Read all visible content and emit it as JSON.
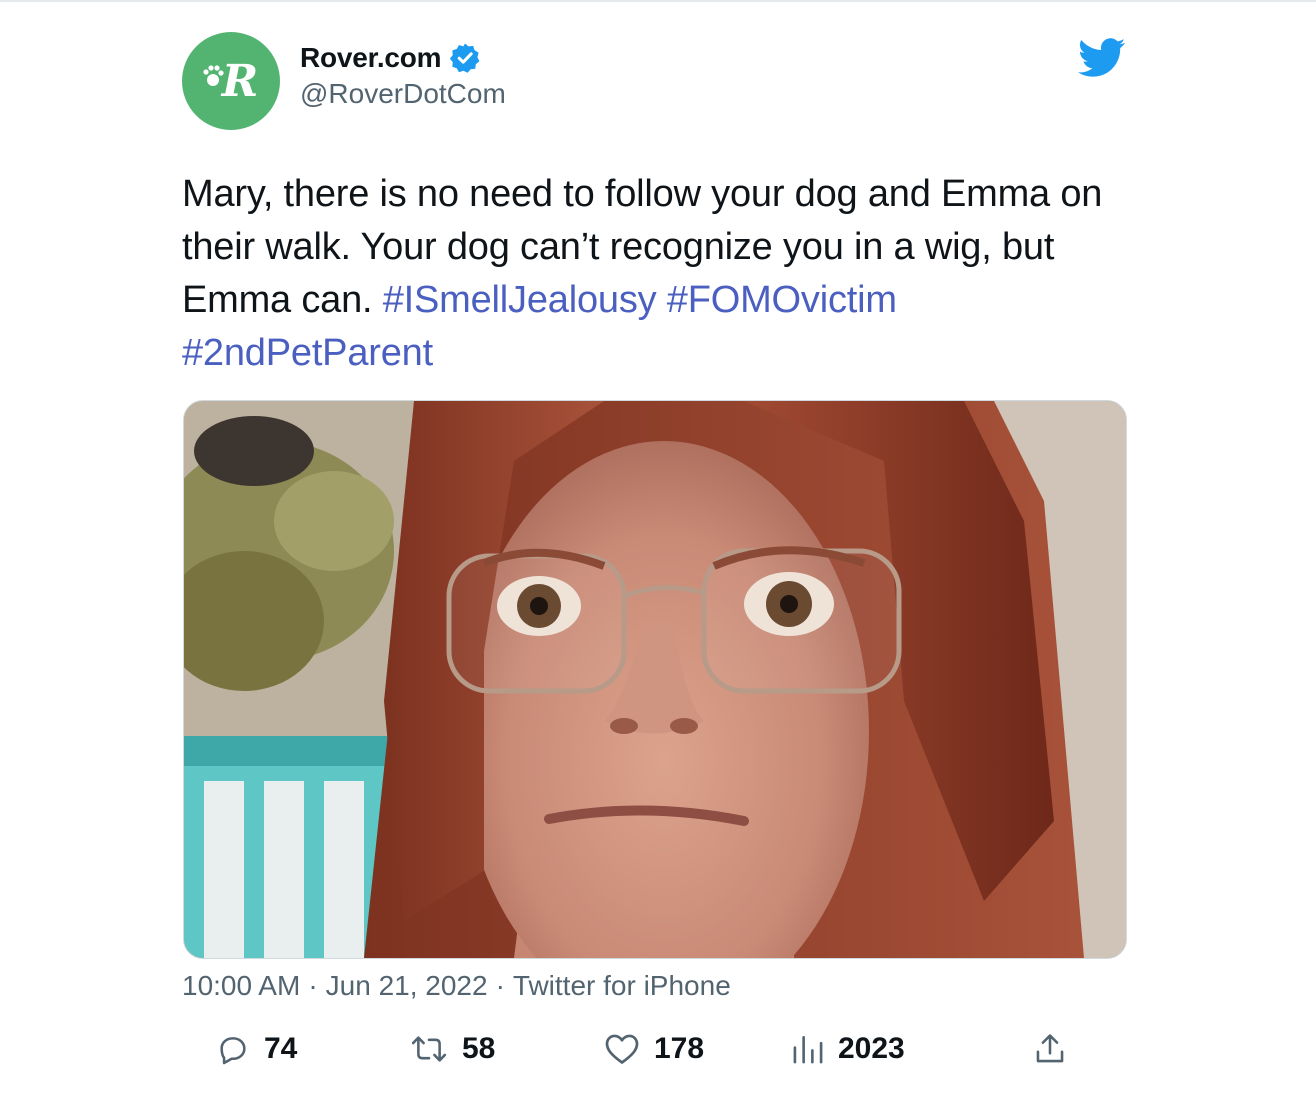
{
  "tweet": {
    "display_name": "Rover.com",
    "handle": "@RoverDotCom",
    "avatar_letter": "R",
    "verified": true,
    "text_plain": "Mary, there is no need to follow your dog and Emma on their walk. Your dog can’t recognize you in a wig, but Emma can.",
    "hashtags": [
      "#ISmellJealousy",
      "#FOMOvictim",
      "#2ndPetParent"
    ],
    "time": "10:00 AM",
    "date": "Jun 21, 2022",
    "source": "Twitter for iPhone",
    "separator": "·"
  },
  "actions": {
    "replies": "74",
    "retweets": "58",
    "likes": "178",
    "views": "2023"
  },
  "icons": {
    "brand": "twitter-bird-icon",
    "verified": "verified-badge-icon",
    "reply": "reply-icon",
    "retweet": "retweet-icon",
    "like": "heart-icon",
    "views": "views-icon",
    "share": "share-icon"
  },
  "colors": {
    "avatar_green": "#53b472",
    "twitter_blue": "#1d9bf0",
    "hashtag_blue": "#4a5fc0",
    "text_primary": "#0f1419",
    "text_secondary": "#536471"
  }
}
